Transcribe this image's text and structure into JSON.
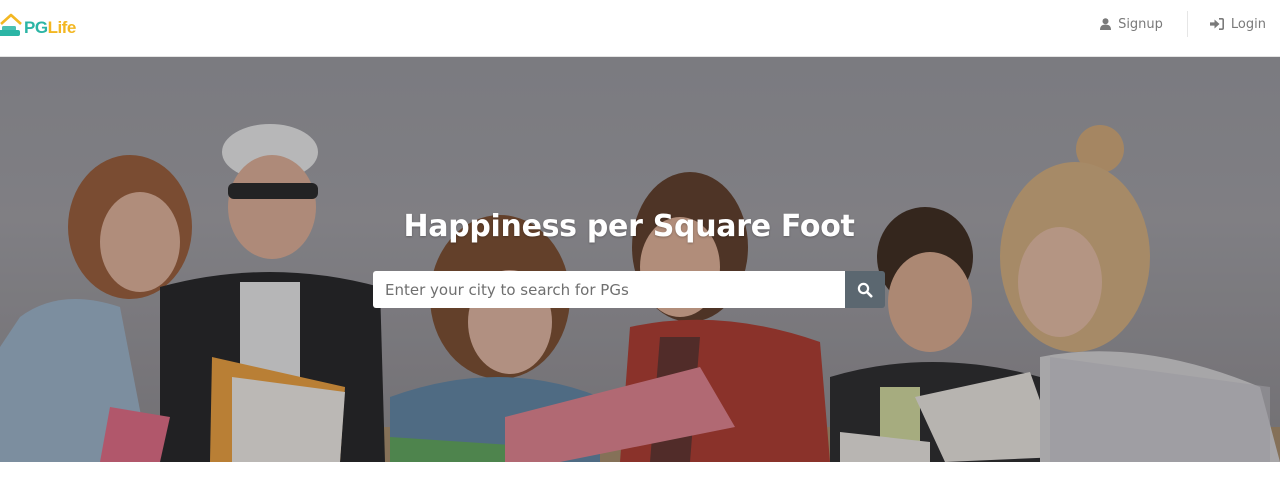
{
  "brand": {
    "pg": "PG",
    "life": "Life",
    "colors": {
      "pg": "#2bb5a5",
      "life": "#f3b722"
    }
  },
  "nav": {
    "signup": {
      "label": "Signup",
      "icon": "user-icon"
    },
    "login": {
      "label": "Login",
      "icon": "sign-in-icon"
    }
  },
  "hero": {
    "title": "Happiness per Square Foot",
    "search": {
      "placeholder": "Enter your city to search for PGs",
      "value": "",
      "button_icon": "search-icon",
      "button_color": "#5b6770"
    }
  }
}
